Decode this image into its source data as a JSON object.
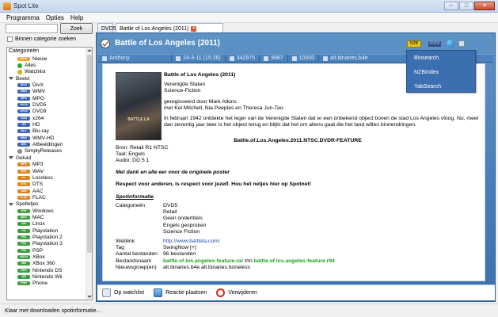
{
  "window": {
    "title": "Spot Lite",
    "min": "─",
    "max": "□",
    "close": "✕"
  },
  "menu": [
    "Programma",
    "Opties",
    "Help"
  ],
  "search": {
    "value": "",
    "button": "Zoek",
    "checkbox_label": "Binnen categorie zoeken"
  },
  "categories": {
    "title": "Categorieën",
    "rows": [
      {
        "type": "item",
        "label": "Nieuw",
        "badge": "NEW",
        "color": "#f0a22b"
      },
      {
        "type": "item",
        "label": "Alles",
        "dot": "#2ea32e"
      },
      {
        "type": "item",
        "label": "Watchlist",
        "dot": "#d7aa1d"
      },
      {
        "type": "group",
        "label": "Beeld"
      },
      {
        "type": "item",
        "label": "DivX",
        "badge": "DIVX",
        "color": "#3a62b6"
      },
      {
        "type": "item",
        "label": "WMV",
        "badge": "WMV",
        "color": "#3a62b6"
      },
      {
        "type": "item",
        "label": "MPG",
        "badge": "MPG",
        "color": "#3a62b6"
      },
      {
        "type": "item",
        "label": "DVD5",
        "badge": "DVD5",
        "color": "#3a62b6"
      },
      {
        "type": "item",
        "label": "DVD9",
        "badge": "DVD9",
        "color": "#3a62b6"
      },
      {
        "type": "item",
        "label": "x264",
        "badge": "X264",
        "color": "#3a62b6"
      },
      {
        "type": "item",
        "label": "HD",
        "badge": "HD",
        "color": "#3a62b6"
      },
      {
        "type": "item",
        "label": "Blu-ray",
        "badge": "BLU",
        "color": "#3a62b6"
      },
      {
        "type": "item",
        "label": "WMV-HD",
        "badge": "WMV",
        "color": "#3a62b6"
      },
      {
        "type": "item",
        "label": "Afbeeldingen",
        "badge": "IMG",
        "color": "#3a62b6"
      },
      {
        "type": "item",
        "label": "SimplyReleases",
        "dot": "#8a8a8a"
      },
      {
        "type": "group",
        "label": "Geluid"
      },
      {
        "type": "item",
        "label": "MP3",
        "badge": "MP3",
        "color": "#d98420"
      },
      {
        "type": "item",
        "label": "WAV",
        "badge": "WAV",
        "color": "#d98420"
      },
      {
        "type": "item",
        "label": "Lossless",
        "badge": "LL",
        "color": "#d98420"
      },
      {
        "type": "item",
        "label": "DTS",
        "badge": "DTS",
        "color": "#d98420"
      },
      {
        "type": "item",
        "label": "AAC",
        "badge": "AAC",
        "color": "#d98420"
      },
      {
        "type": "item",
        "label": "FLAC",
        "badge": "FLAC",
        "color": "#d98420"
      },
      {
        "type": "group",
        "label": "Spelletjes"
      },
      {
        "type": "item",
        "label": "Windows",
        "badge": "WIN",
        "color": "#3c9d3c"
      },
      {
        "type": "item",
        "label": "MAC",
        "badge": "MAC",
        "color": "#3c9d3c"
      },
      {
        "type": "item",
        "label": "Linux",
        "badge": "LNX",
        "color": "#3c9d3c"
      },
      {
        "type": "item",
        "label": "Playstation",
        "badge": "PS",
        "color": "#3c9d3c"
      },
      {
        "type": "item",
        "label": "Playstation 2",
        "badge": "PS2",
        "color": "#3c9d3c"
      },
      {
        "type": "item",
        "label": "Playstation 3",
        "badge": "PS3",
        "color": "#3c9d3c"
      },
      {
        "type": "item",
        "label": "PSP",
        "badge": "PSP",
        "color": "#3c9d3c"
      },
      {
        "type": "item",
        "label": "XBox",
        "badge": "XBOX",
        "color": "#3c9d3c"
      },
      {
        "type": "item",
        "label": "XBox 360",
        "badge": "360",
        "color": "#3c9d3c"
      },
      {
        "type": "item",
        "label": "Nintendo DS",
        "badge": "NDS",
        "color": "#3c9d3c"
      },
      {
        "type": "item",
        "label": "Nintendo Wii",
        "badge": "WII",
        "color": "#3c9d3c"
      },
      {
        "type": "item",
        "label": "Phone",
        "badge": "PHN",
        "color": "#3c9d3c"
      }
    ]
  },
  "tabs": [
    {
      "label": "DVD5",
      "active": false
    },
    {
      "label": "Battle of Los Angeles (2011)",
      "active": true,
      "close": "✕"
    }
  ],
  "spot": {
    "title": "Battle of Los Angeles (2011)",
    "nzb_badge": "NZB",
    "dvd_badge": "DVD5",
    "info": {
      "poster": "Anthony",
      "date": "24-3-11 (15:26)",
      "id": "342975",
      "votes": "9987",
      "size": "10000",
      "group": "alt.binaries.b4e"
    },
    "dropdown": [
      "Binsearch",
      "NZBIndex",
      "YabSearch"
    ],
    "poster_caption": "BATTLE LA",
    "movie_title": "Battle of Los Angeles (2011)",
    "origin": "Verenigde Staten",
    "genre": "Science-Fiction",
    "director": "geregisseerd door Mark Atkins",
    "cast": "met Kel Mitchell, Nia Peeples en Theresa Jun-Tao",
    "description": "In februari 1942 ontdekte het leger van de Verenigde Staten dat er een onbekend object boven de stad Los Angeles vloog. Nu, meer dan zeventig jaar later is het object terug en blijkt dat het om aliens gaat die het land willen binnendringen.",
    "release_name": "Battle.of.Los.Angeles.2011.NTSC.DVDR-FEATURE",
    "source": "Bron: Retail R1 NTSC",
    "language": "Taal: Engels",
    "audio": "Audio: DD 5.1",
    "thanks": "Met dank en alle eer voor de originele poster",
    "respect": "Respect voor anderen, is respect voor jezelf. Hou het netjes hier op Spotnet!",
    "section": "Spotinformatie",
    "fields": {
      "cat_label": "Categorieën",
      "cat_values": [
        "DVD5",
        "Retail",
        "Geen ondertitels",
        "Engels gesproken",
        "Science Fiction"
      ],
      "weblink_label": "Weblink",
      "weblink": "http://www.battlela.com/",
      "tag_label": "Tag",
      "tag": "SwingNow [+]",
      "count_label": "Aantal bestanden",
      "count": "96 bestanden",
      "files_label": "Bestandsnaam",
      "files_first": "battle.of.los.angeles-feature.rar",
      "files_sep": "t/m",
      "files_last": "battle.of.los.angeles-feature.r94",
      "groups_label": "Nieuwsgroep(en)",
      "groups": "alt.binaries.b4e alt.binaries.boneless"
    }
  },
  "actions": {
    "watchlist": "Op watchlist",
    "reply": "Reactie plaatsen",
    "delete": "Verwijderen"
  },
  "status": "Klaar met downloaden spotinformatie..."
}
